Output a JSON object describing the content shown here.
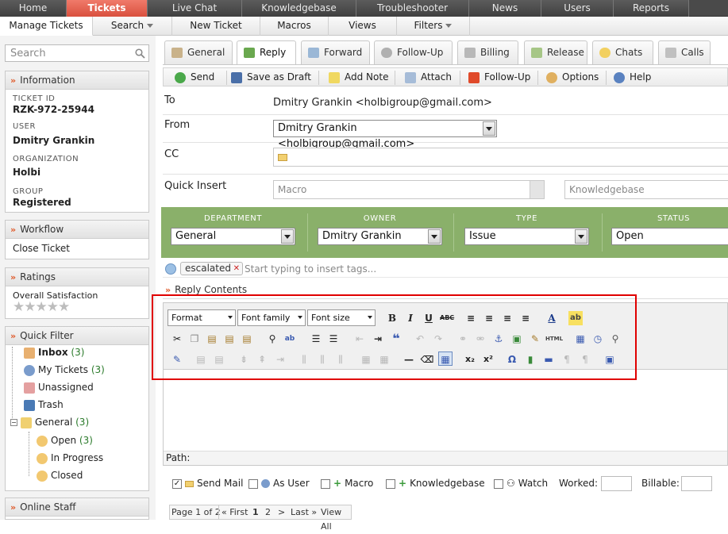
{
  "nav": {
    "top": [
      "Home",
      "Tickets",
      "Live Chat",
      "Knowledgebase",
      "Troubleshooter",
      "News",
      "Users",
      "Reports"
    ],
    "sub": [
      "Manage Tickets",
      "Search",
      "New Ticket",
      "Macros",
      "Views",
      "Filters"
    ]
  },
  "sidebar": {
    "search_placeholder": "Search",
    "information": {
      "title": "Information",
      "ticket_id_label": "TICKET ID",
      "ticket_id": "RZK-972-25944",
      "user_label": "USER",
      "user": "Dmitry Grankin",
      "org_label": "ORGANIZATION",
      "org": "Holbi",
      "group_label": "GROUP",
      "group": "Registered"
    },
    "workflow": {
      "title": "Workflow",
      "item": "Close Ticket"
    },
    "ratings": {
      "title": "Ratings",
      "item": "Overall Satisfaction"
    },
    "quick_filter": {
      "title": "Quick Filter",
      "inbox": "Inbox",
      "inbox_count": "(3)",
      "my": "My Tickets",
      "my_count": "(3)",
      "unassigned": "Unassigned",
      "trash": "Trash",
      "general": "General",
      "general_count": "(3)",
      "open": "Open",
      "open_count": "(3)",
      "inprogress": "In Progress",
      "closed": "Closed"
    },
    "online_staff": {
      "title": "Online Staff"
    }
  },
  "tabs": [
    "General",
    "Reply",
    "Forward",
    "Follow-Up",
    "Billing",
    "Release",
    "Chats",
    "Calls"
  ],
  "toolbar": [
    "Send",
    "Save as Draft",
    "Add Note",
    "Attach",
    "Follow-Up",
    "Options",
    "Help"
  ],
  "form": {
    "to_label": "To",
    "to_value": "Dmitry Grankin <holbigroup@gmail.com>",
    "from_label": "From",
    "from_value": "Dmitry Grankin <holbigroup@gmail.com>",
    "cc_label": "CC",
    "qi_label": "Quick Insert",
    "macro_placeholder": "Macro",
    "kb_placeholder": "Knowledgebase"
  },
  "props": {
    "dept_label": "DEPARTMENT",
    "dept": "General",
    "owner_label": "OWNER",
    "owner": "Dmitry Grankin",
    "type_label": "TYPE",
    "type": "Issue",
    "status_label": "STATUS",
    "status": "Open"
  },
  "tags": {
    "tag": "escalated",
    "placeholder": "Start typing to insert tags..."
  },
  "reply": {
    "title": "Reply Contents",
    "format": "Format",
    "font_family": "Font family",
    "font_size": "Font size",
    "path": "Path:"
  },
  "options": {
    "send_mail": "Send Mail",
    "as_user": "As User",
    "macro": "Macro",
    "kb": "Knowledgebase",
    "watch": "Watch",
    "worked": "Worked:",
    "billable": "Billable:"
  },
  "pager": {
    "page": "Page 1 of 2",
    "first": "« First",
    "p1": "1",
    "p2": "2",
    "next": ">",
    "last": "Last »",
    "all": "View All"
  }
}
